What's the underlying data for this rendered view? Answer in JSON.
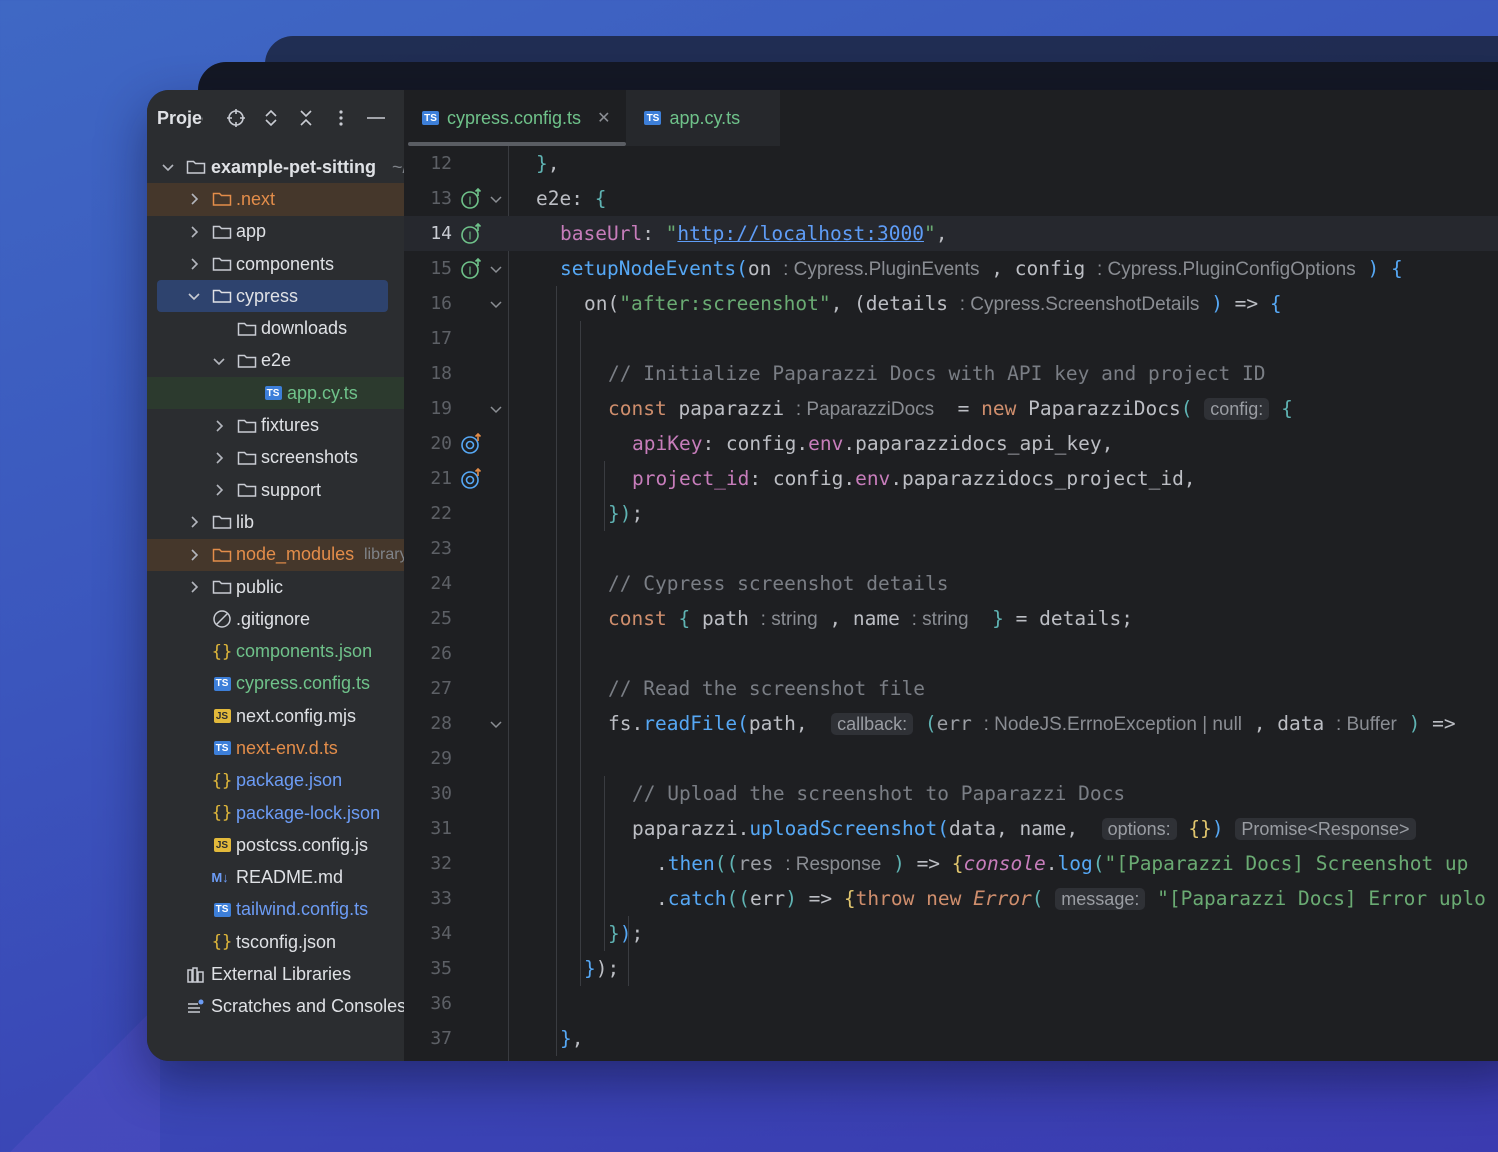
{
  "project_panel": {
    "title": "Project",
    "tree": [
      {
        "label": "example-pet-sitting",
        "suffix": "~/",
        "kind": "root-folder",
        "expanded": true
      },
      {
        "label": ".next",
        "kind": "folder",
        "color": "orange"
      },
      {
        "label": "app",
        "kind": "folder"
      },
      {
        "label": "components",
        "kind": "folder"
      },
      {
        "label": "cypress",
        "kind": "folder",
        "expanded": true,
        "selected": true
      },
      {
        "label": "downloads",
        "kind": "folder"
      },
      {
        "label": "e2e",
        "kind": "folder",
        "expanded": true
      },
      {
        "label": "app.cy.ts",
        "kind": "ts-test-file",
        "color": "green"
      },
      {
        "label": "fixtures",
        "kind": "folder"
      },
      {
        "label": "screenshots",
        "kind": "folder"
      },
      {
        "label": "support",
        "kind": "folder"
      },
      {
        "label": "lib",
        "kind": "folder"
      },
      {
        "label": "node_modules",
        "suffix": "library root",
        "kind": "folder",
        "color": "orange"
      },
      {
        "label": "public",
        "kind": "folder"
      },
      {
        "label": ".gitignore",
        "kind": "ignore-file"
      },
      {
        "label": "components.json",
        "kind": "json-file",
        "color": "green"
      },
      {
        "label": "cypress.config.ts",
        "kind": "ts-file",
        "color": "green"
      },
      {
        "label": "next.config.mjs",
        "kind": "js-file"
      },
      {
        "label": "next-env.d.ts",
        "kind": "ts-file",
        "color": "orange"
      },
      {
        "label": "package.json",
        "kind": "json-file",
        "color": "blue"
      },
      {
        "label": "package-lock.json",
        "kind": "json-file",
        "color": "blue"
      },
      {
        "label": "postcss.config.js",
        "kind": "js-file"
      },
      {
        "label": "README.md",
        "kind": "md-file"
      },
      {
        "label": "tailwind.config.ts",
        "kind": "ts-file",
        "color": "blue"
      },
      {
        "label": "tsconfig.json",
        "kind": "json-file"
      },
      {
        "label": "External Libraries",
        "kind": "libraries"
      },
      {
        "label": "Scratches and Consoles",
        "kind": "scratches"
      }
    ]
  },
  "tabs": [
    {
      "label": "cypress.config.ts",
      "active": true
    },
    {
      "label": "app.cy.ts",
      "active": false
    }
  ],
  "editor": {
    "lines": [
      "12",
      "13",
      "14",
      "15",
      "16",
      "17",
      "18",
      "19",
      "20",
      "21",
      "22",
      "23",
      "24",
      "25",
      "26",
      "27",
      "28",
      "29",
      "30",
      "31",
      "32",
      "33",
      "34",
      "35",
      "36",
      "37"
    ],
    "current_line": "14",
    "hints": {
      "on_type": ": Cypress.PluginEvents",
      "config_type": ": Cypress.PluginConfigOptions",
      "details_type": ": Cypress.ScreenshotDetails",
      "paparazzi_type": ": PaparazziDocs",
      "config_param": "config:",
      "path_type": ": string",
      "name_type": ": string",
      "callback_param": "callback:",
      "err_type": ": NodeJS.ErrnoException | null",
      "data_type": ": Buffer",
      "options_param": "options:",
      "promise_type": "Promise<Response>",
      "res_type": ": Response",
      "message_param": "message:"
    },
    "strings": {
      "base_url": "http://localhost:3000",
      "event_name": "\"after:screenshot\"",
      "comment_init": "// Initialize Paparazzi Docs with API key and project ID",
      "comment_details": "// Cypress screenshot details",
      "comment_read": "// Read the screenshot file",
      "comment_upload": "// Upload the screenshot to Paparazzi Docs",
      "then_msg": "\"[Paparazzi Docs] Screenshot up",
      "catch_msg": "\"[Paparazzi Docs] Error uplo"
    }
  }
}
